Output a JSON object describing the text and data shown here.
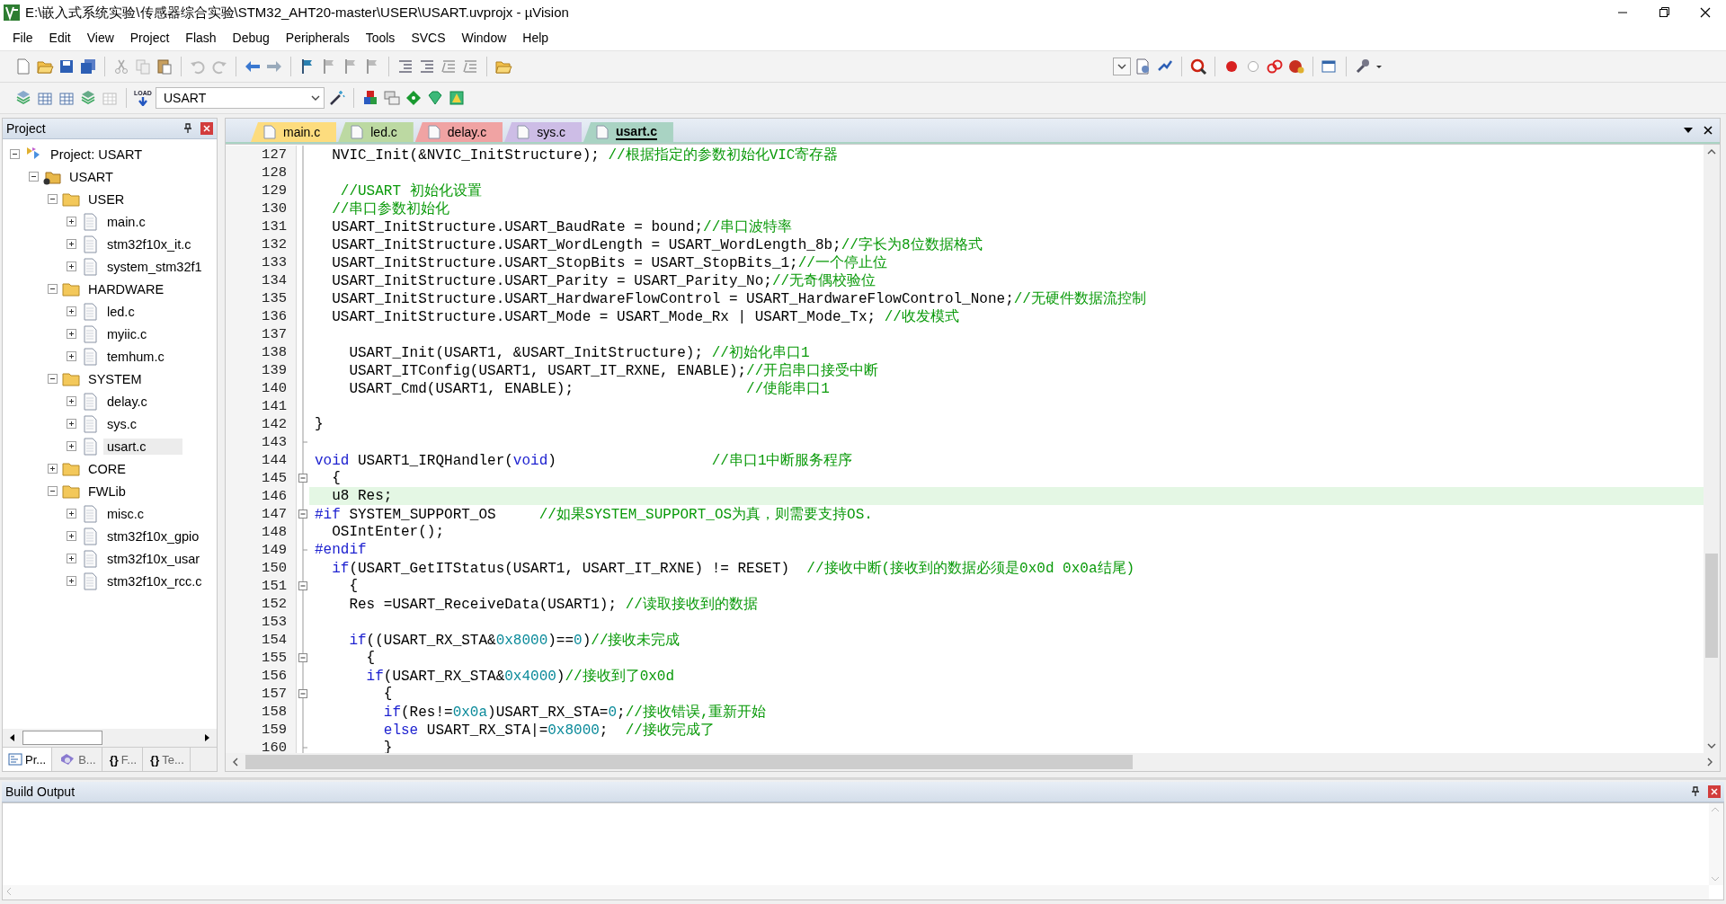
{
  "window": {
    "title": "E:\\嵌入式系统实验\\传感器综合实验\\STM32_AHT20-master\\USER\\USART.uvprojx - µVision"
  },
  "menu": [
    "File",
    "Edit",
    "View",
    "Project",
    "Flash",
    "Debug",
    "Peripherals",
    "Tools",
    "SVCS",
    "Window",
    "Help"
  ],
  "toolbar": {
    "target": "USART",
    "load_label": "LOAD"
  },
  "project_panel": {
    "title": "Project",
    "tree": [
      {
        "label": "Project: USART",
        "kind": "project",
        "expanded": true,
        "selected": false,
        "children": [
          {
            "label": "USART",
            "kind": "target",
            "expanded": true,
            "selected": false,
            "children": [
              {
                "label": "USER",
                "kind": "folder",
                "expanded": true,
                "selected": false,
                "children": [
                  {
                    "label": "main.c",
                    "kind": "file",
                    "expanded": false,
                    "selected": false
                  },
                  {
                    "label": "stm32f10x_it.c",
                    "kind": "file",
                    "expanded": false,
                    "selected": false
                  },
                  {
                    "label": "system_stm32f1",
                    "kind": "file",
                    "expanded": false,
                    "selected": false
                  }
                ]
              },
              {
                "label": "HARDWARE",
                "kind": "folder",
                "expanded": true,
                "selected": false,
                "children": [
                  {
                    "label": "led.c",
                    "kind": "file",
                    "expanded": false,
                    "selected": false
                  },
                  {
                    "label": "myiic.c",
                    "kind": "file",
                    "expanded": false,
                    "selected": false
                  },
                  {
                    "label": "temhum.c",
                    "kind": "file",
                    "expanded": false,
                    "selected": false
                  }
                ]
              },
              {
                "label": "SYSTEM",
                "kind": "folder",
                "expanded": true,
                "selected": false,
                "children": [
                  {
                    "label": "delay.c",
                    "kind": "file",
                    "expanded": false,
                    "selected": false
                  },
                  {
                    "label": "sys.c",
                    "kind": "file",
                    "expanded": false,
                    "selected": false
                  },
                  {
                    "label": "usart.c",
                    "kind": "file",
                    "expanded": false,
                    "selected": true
                  }
                ]
              },
              {
                "label": "CORE",
                "kind": "folder",
                "expanded": false,
                "selected": false
              },
              {
                "label": "FWLib",
                "kind": "folder",
                "expanded": true,
                "selected": false,
                "children": [
                  {
                    "label": "misc.c",
                    "kind": "file",
                    "expanded": false,
                    "selected": false
                  },
                  {
                    "label": "stm32f10x_gpio",
                    "kind": "file",
                    "expanded": false,
                    "selected": false
                  },
                  {
                    "label": "stm32f10x_usar",
                    "kind": "file",
                    "expanded": false,
                    "selected": false
                  },
                  {
                    "label": "stm32f10x_rcc.c",
                    "kind": "file",
                    "expanded": false,
                    "selected": false
                  }
                ]
              }
            ]
          }
        ]
      }
    ],
    "bottom_tabs": [
      {
        "label": "Pr...",
        "selected": true
      },
      {
        "label": "B...",
        "selected": false
      },
      {
        "glyph": "{}",
        "label": "F...",
        "selected": false
      },
      {
        "glyph": "{}",
        "label": "Te...",
        "selected": false
      }
    ]
  },
  "editor": {
    "tabs": [
      {
        "label": "main.c",
        "color": "#fddc7e",
        "selected": false
      },
      {
        "label": "led.c",
        "color": "#bcd9a2",
        "selected": false
      },
      {
        "label": "delay.c",
        "color": "#f0a3a3",
        "selected": false
      },
      {
        "label": "sys.c",
        "color": "#cdbde6",
        "selected": false
      },
      {
        "label": "usart.c",
        "color": "#a9d3c3",
        "selected": true
      }
    ],
    "lines": [
      {
        "number": "127",
        "foldable": false,
        "fold_end": false,
        "highlighted": false,
        "tokens": [
          {
            "kind": "code",
            "text": "  NVIC_Init(&NVIC_InitStructure); "
          },
          {
            "kind": "comment",
            "text": "//根据指定的参数初始化VIC寄存器"
          }
        ]
      },
      {
        "number": "128",
        "foldable": false,
        "fold_end": false,
        "highlighted": false
      },
      {
        "number": "129",
        "foldable": false,
        "fold_end": false,
        "highlighted": false,
        "tokens": [
          {
            "kind": "comment",
            "text": "   //USART 初始化设置"
          }
        ]
      },
      {
        "number": "130",
        "foldable": false,
        "fold_end": false,
        "highlighted": false,
        "tokens": [
          {
            "kind": "comment",
            "text": "  //串口参数初始化"
          }
        ]
      },
      {
        "number": "131",
        "foldable": false,
        "fold_end": false,
        "highlighted": false,
        "tokens": [
          {
            "kind": "code",
            "text": "  USART_InitStructure.USART_BaudRate = bound;"
          },
          {
            "kind": "comment",
            "text": "//串口波特率"
          }
        ]
      },
      {
        "number": "132",
        "foldable": false,
        "fold_end": false,
        "highlighted": false,
        "tokens": [
          {
            "kind": "code",
            "text": "  USART_InitStructure.USART_WordLength = USART_WordLength_8b;"
          },
          {
            "kind": "comment",
            "text": "//字长为8位数据格式"
          }
        ]
      },
      {
        "number": "133",
        "foldable": false,
        "fold_end": false,
        "highlighted": false,
        "tokens": [
          {
            "kind": "code",
            "text": "  USART_InitStructure.USART_StopBits = USART_StopBits_1;"
          },
          {
            "kind": "comment",
            "text": "//一个停止位"
          }
        ]
      },
      {
        "number": "134",
        "foldable": false,
        "fold_end": false,
        "highlighted": false,
        "tokens": [
          {
            "kind": "code",
            "text": "  USART_InitStructure.USART_Parity = USART_Parity_No;"
          },
          {
            "kind": "comment",
            "text": "//无奇偶校验位"
          }
        ]
      },
      {
        "number": "135",
        "foldable": false,
        "fold_end": false,
        "highlighted": false,
        "tokens": [
          {
            "kind": "code",
            "text": "  USART_InitStructure.USART_HardwareFlowControl = USART_HardwareFlowControl_None;"
          },
          {
            "kind": "comment",
            "text": "//无硬件数据流控制"
          }
        ]
      },
      {
        "number": "136",
        "foldable": false,
        "fold_end": false,
        "highlighted": false,
        "tokens": [
          {
            "kind": "code",
            "text": "  USART_InitStructure.USART_Mode = USART_Mode_Rx | USART_Mode_Tx; "
          },
          {
            "kind": "comment",
            "text": "//收发模式"
          }
        ]
      },
      {
        "number": "137",
        "foldable": false,
        "fold_end": false,
        "highlighted": false
      },
      {
        "number": "138",
        "foldable": false,
        "fold_end": false,
        "highlighted": false,
        "tokens": [
          {
            "kind": "code",
            "text": "    USART_Init(USART1, &USART_InitStructure); "
          },
          {
            "kind": "comment",
            "text": "//初始化串口1"
          }
        ]
      },
      {
        "number": "139",
        "foldable": false,
        "fold_end": false,
        "highlighted": false,
        "tokens": [
          {
            "kind": "code",
            "text": "    USART_ITConfig(USART1, USART_IT_RXNE, ENABLE);"
          },
          {
            "kind": "comment",
            "text": "//开启串口接受中断"
          }
        ]
      },
      {
        "number": "140",
        "foldable": false,
        "fold_end": false,
        "highlighted": false,
        "tokens": [
          {
            "kind": "code",
            "text": "    USART_Cmd(USART1, ENABLE);                    "
          },
          {
            "kind": "comment",
            "text": "//使能串口1"
          }
        ]
      },
      {
        "number": "141",
        "foldable": false,
        "fold_end": false,
        "highlighted": false
      },
      {
        "number": "142",
        "foldable": false,
        "fold_end": false,
        "highlighted": false,
        "tokens": [
          {
            "kind": "code",
            "text": "}"
          }
        ]
      },
      {
        "number": "143",
        "foldable": false,
        "fold_end": true,
        "highlighted": false
      },
      {
        "number": "144",
        "foldable": false,
        "fold_end": false,
        "highlighted": false,
        "tokens": [
          {
            "kind": "keyword",
            "text": "void"
          },
          {
            "kind": "code",
            "text": " USART1_IRQHandler("
          },
          {
            "kind": "keyword",
            "text": "void"
          },
          {
            "kind": "code",
            "text": ")                  "
          },
          {
            "kind": "comment",
            "text": "//串口1中断服务程序"
          }
        ]
      },
      {
        "number": "145",
        "foldable": true,
        "fold_end": false,
        "highlighted": false,
        "tokens": [
          {
            "kind": "code",
            "text": "  {"
          }
        ]
      },
      {
        "number": "146",
        "foldable": false,
        "fold_end": false,
        "highlighted": true,
        "tokens": [
          {
            "kind": "code",
            "text": "  u8 Res;"
          }
        ]
      },
      {
        "number": "147",
        "foldable": true,
        "fold_end": false,
        "highlighted": false,
        "tokens": [
          {
            "kind": "keyword",
            "text": "#if"
          },
          {
            "kind": "code",
            "text": " SYSTEM_SUPPORT_OS     "
          },
          {
            "kind": "comment",
            "text": "//如果SYSTEM_SUPPORT_OS为真，则需要支持OS."
          }
        ]
      },
      {
        "number": "148",
        "foldable": false,
        "fold_end": false,
        "highlighted": false,
        "tokens": [
          {
            "kind": "code",
            "text": "  OSIntEnter();"
          }
        ]
      },
      {
        "number": "149",
        "foldable": false,
        "fold_end": true,
        "highlighted": false,
        "tokens": [
          {
            "kind": "keyword",
            "text": "#endif"
          }
        ]
      },
      {
        "number": "150",
        "foldable": false,
        "fold_end": false,
        "highlighted": false,
        "tokens": [
          {
            "kind": "keyword",
            "text": "  if"
          },
          {
            "kind": "code",
            "text": "(USART_GetITStatus(USART1, USART_IT_RXNE) != RESET)  "
          },
          {
            "kind": "comment",
            "text": "//接收中断(接收到的数据必须是0x0d 0x0a结尾)"
          }
        ]
      },
      {
        "number": "151",
        "foldable": true,
        "fold_end": false,
        "highlighted": false,
        "tokens": [
          {
            "kind": "code",
            "text": "    {"
          }
        ]
      },
      {
        "number": "152",
        "foldable": false,
        "fold_end": false,
        "highlighted": false,
        "tokens": [
          {
            "kind": "code",
            "text": "    Res =USART_ReceiveData(USART1); "
          },
          {
            "kind": "comment",
            "text": "//读取接收到的数据"
          }
        ]
      },
      {
        "number": "153",
        "foldable": false,
        "fold_end": false,
        "highlighted": false
      },
      {
        "number": "154",
        "foldable": false,
        "fold_end": false,
        "highlighted": false,
        "tokens": [
          {
            "kind": "keyword",
            "text": "    if"
          },
          {
            "kind": "code",
            "text": "((USART_RX_STA&"
          },
          {
            "kind": "number",
            "text": "0x8000"
          },
          {
            "kind": "code",
            "text": ")=="
          },
          {
            "kind": "number",
            "text": "0"
          },
          {
            "kind": "code",
            "text": ")"
          },
          {
            "kind": "comment",
            "text": "//接收未完成"
          }
        ]
      },
      {
        "number": "155",
        "foldable": true,
        "fold_end": false,
        "highlighted": false,
        "tokens": [
          {
            "kind": "code",
            "text": "      {"
          }
        ]
      },
      {
        "number": "156",
        "foldable": false,
        "fold_end": false,
        "highlighted": false,
        "tokens": [
          {
            "kind": "keyword",
            "text": "      if"
          },
          {
            "kind": "code",
            "text": "(USART_RX_STA&"
          },
          {
            "kind": "number",
            "text": "0x4000"
          },
          {
            "kind": "code",
            "text": ")"
          },
          {
            "kind": "comment",
            "text": "//接收到了0x0d"
          }
        ]
      },
      {
        "number": "157",
        "foldable": true,
        "fold_end": false,
        "highlighted": false,
        "tokens": [
          {
            "kind": "code",
            "text": "        {"
          }
        ]
      },
      {
        "number": "158",
        "foldable": false,
        "fold_end": false,
        "highlighted": false,
        "tokens": [
          {
            "kind": "keyword",
            "text": "        if"
          },
          {
            "kind": "code",
            "text": "(Res!="
          },
          {
            "kind": "number",
            "text": "0x0a"
          },
          {
            "kind": "code",
            "text": ")USART_RX_STA="
          },
          {
            "kind": "number",
            "text": "0"
          },
          {
            "kind": "code",
            "text": ";"
          },
          {
            "kind": "comment",
            "text": "//接收错误,重新开始"
          }
        ]
      },
      {
        "number": "159",
        "foldable": false,
        "fold_end": false,
        "highlighted": false,
        "tokens": [
          {
            "kind": "keyword",
            "text": "        else"
          },
          {
            "kind": "code",
            "text": " USART_RX_STA|="
          },
          {
            "kind": "number",
            "text": "0x8000"
          },
          {
            "kind": "code",
            "text": ";  "
          },
          {
            "kind": "comment",
            "text": "//接收完成了"
          }
        ]
      },
      {
        "number": "160",
        "foldable": false,
        "fold_end": true,
        "highlighted": false,
        "tokens": [
          {
            "kind": "code",
            "text": "        }"
          }
        ]
      }
    ]
  },
  "build_output": {
    "title": "Build Output"
  }
}
